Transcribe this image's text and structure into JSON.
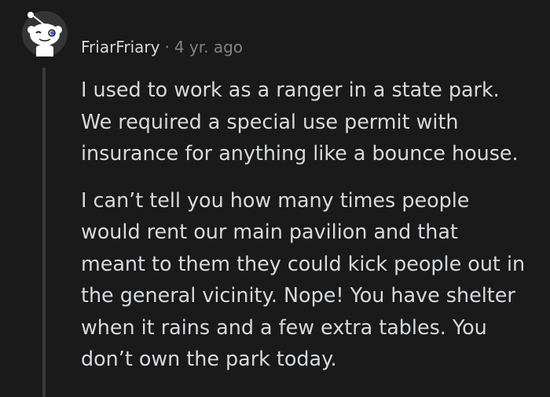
{
  "comment": {
    "author": "FriarFriary",
    "separator": "·",
    "age": "4 yr. ago",
    "paragraphs": [
      "I used to work as a ranger in a state park.\nWe required a special use permit with\ninsurance for anything like a bounce house.",
      "I can’t tell you how many times people\nwould rent our main pavilion and that\nmeant to them they could kick people out in\nthe general vicinity. Nope! You have shelter\nwhen it rains and a few extra tables. You\ndon’t own the park today."
    ]
  },
  "avatar": {
    "icon": "reddit-snoo-avatar",
    "background": "#343536"
  },
  "colors": {
    "background": "#1a1a1b",
    "text": "#d7dadc",
    "meta": "#818384",
    "thread_line": "#3a3a3c"
  }
}
